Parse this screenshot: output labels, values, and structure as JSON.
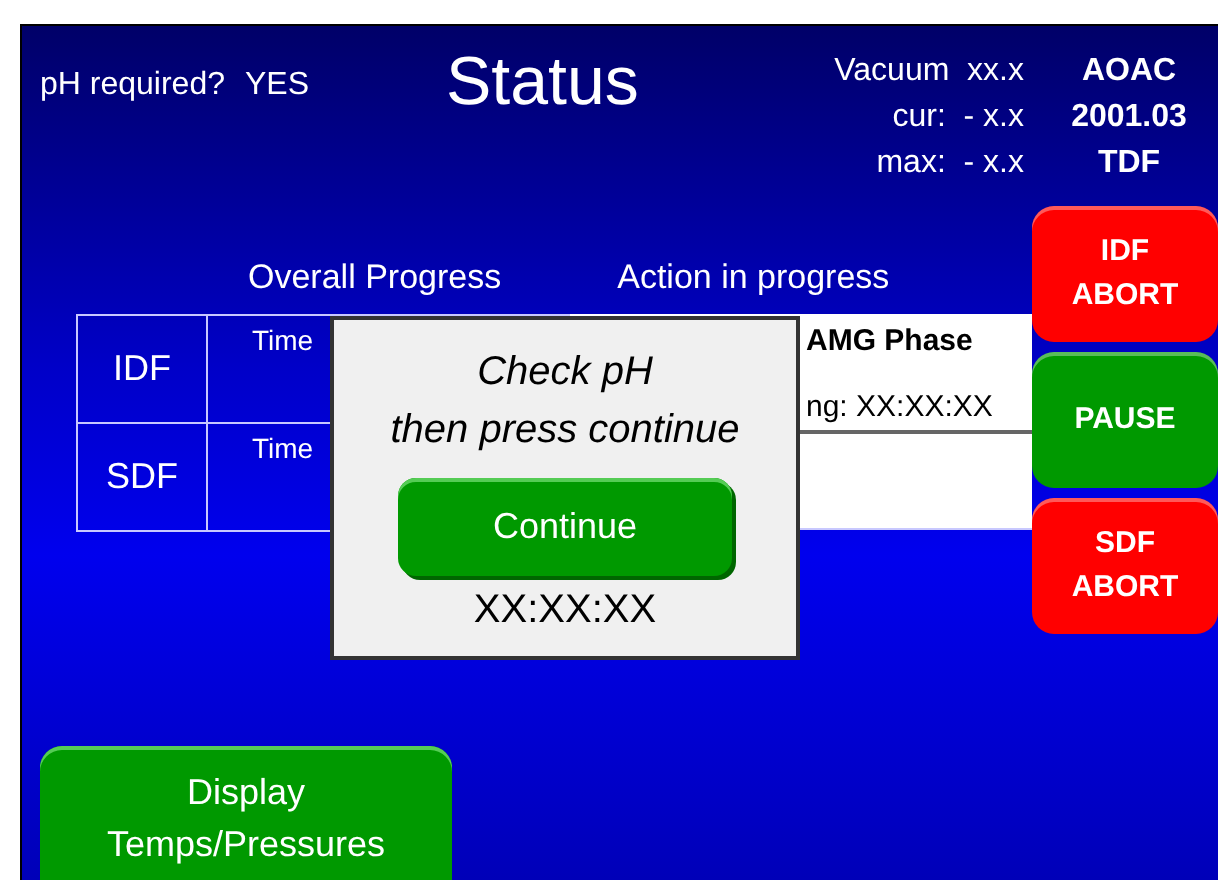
{
  "header": {
    "ph_label": "pH required?",
    "ph_value": "YES",
    "title": "Status",
    "vacuum": [
      "Vacuum  xx.x",
      "cur:  - x.x",
      "max:  - x.x"
    ],
    "method": [
      "AOAC",
      "2001.03",
      "TDF"
    ]
  },
  "headings": [
    "Overall Progress",
    "Action in progress"
  ],
  "rows": [
    {
      "label": "IDF",
      "time_label": "Time"
    },
    {
      "label": "SDF",
      "time_label": "Time"
    }
  ],
  "action": {
    "phase": "AMG Phase",
    "remaining": "ng: XX:XX:XX"
  },
  "dialog": {
    "message": "Check pH",
    "message_2": "then press continue",
    "button": "Continue",
    "timer": "XX:XX:XX"
  },
  "side_buttons": [
    {
      "label": "IDF\nABORT",
      "kind": "abort"
    },
    {
      "label": "PAUSE",
      "kind": "pause"
    },
    {
      "label": "SDF\nABORT",
      "kind": "abort"
    }
  ],
  "bottom_button": "Display\nTemps/Pressures"
}
